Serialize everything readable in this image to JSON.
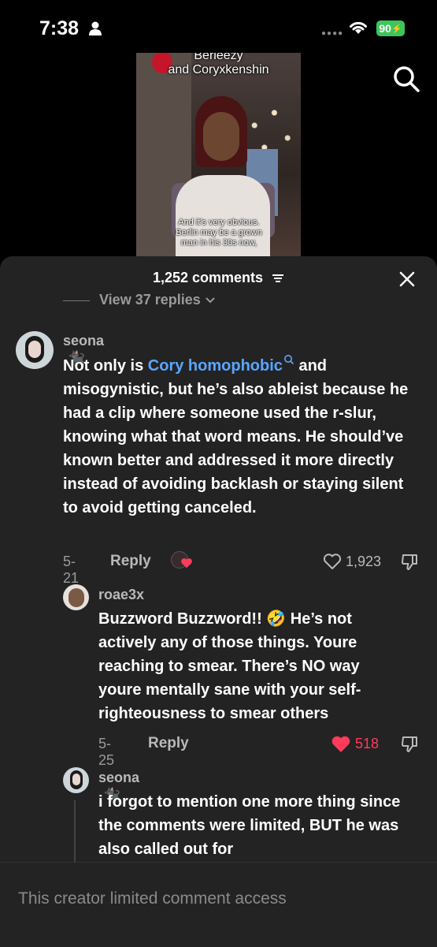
{
  "status_bar": {
    "time": "7:38",
    "battery": "90"
  },
  "video": {
    "caption_top_1": "Berleezy",
    "caption_top_2": "and Coryxkenshin",
    "caption_bottom_1": "And it's very obvious.",
    "caption_bottom_2": "Berlin may be a grown",
    "caption_bottom_3": "man in his 30s now,"
  },
  "sheet": {
    "title": "1,252 comments",
    "view_replies": "View 37 replies"
  },
  "comments": [
    {
      "username": "seona",
      "text_pre": "Not only is ",
      "link": "Cory homophobic",
      "text_post": " and misogynistic, but he’s also ableist because he had a clip where someone used the r-slur, knowing what that word means. He should’ve known better and addressed it more directly instead of avoiding backlash or staying silent to avoid getting canceled.",
      "date": "5-21",
      "reply_label": "Reply",
      "likes": "1,923"
    },
    {
      "username": "roae3x",
      "text": "Buzzword Buzzword!! 🤣 He’s not actively any of those things. Youre reaching to smear. There’s NO way youre mentally sane with your self-righteousness to smear others",
      "date": "5-25",
      "reply_label": "Reply",
      "likes": "518"
    },
    {
      "username": "seona",
      "text": "i forgot to mention one more thing since the comments were limited, BUT he was also called out for"
    }
  ],
  "bottom_bar": {
    "text": "This creator limited comment access"
  },
  "colors": {
    "link": "#5aa6ff",
    "like_active": "#ff3b5c",
    "battery": "#3cc65a",
    "sheet_bg": "#232323"
  }
}
